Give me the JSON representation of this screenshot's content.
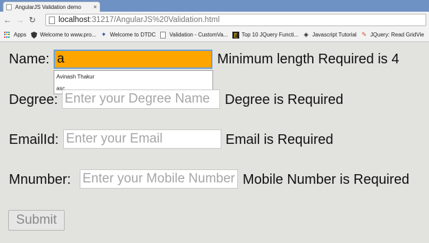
{
  "browser": {
    "tab_title": "AngularJS Validation demo",
    "tab_close": "×",
    "url_host": "localhost",
    "url_path": ":31217/AngularJS%20Validation.html",
    "bookmarks": [
      {
        "label": "Apps",
        "icon": "apps-icon"
      },
      {
        "label": "Welcome to www.pro...",
        "icon": "shield-icon"
      },
      {
        "label": "Welcome to DTDC",
        "icon": "runner-icon"
      },
      {
        "label": "Validation - CustomVa...",
        "icon": "page-icon"
      },
      {
        "label": "Top 10 JQuery Functi...",
        "icon": "e-icon"
      },
      {
        "label": "Javascript Tutorial",
        "icon": "diamond-icon"
      },
      {
        "label": "JQuery: Read GridVie",
        "icon": "blog-icon"
      }
    ]
  },
  "form": {
    "name": {
      "label": "Name:",
      "value": "a",
      "message": "Minimum length Required is 4",
      "autocomplete": [
        "Avinash Thakur",
        "asc"
      ]
    },
    "degree": {
      "label": "Degree:",
      "placeholder": "Enter your Degree Name",
      "message": "Degree is Required"
    },
    "email": {
      "label": "EmailId:",
      "placeholder": "Enter your Email",
      "message": "Email is Required"
    },
    "mobile": {
      "label": "Mnumber:",
      "placeholder": "Enter your Mobile Number",
      "message": "Mobile Number is Required"
    },
    "submit_label": "Submit"
  },
  "colors": {
    "focused_field_bg": "#ffa500",
    "tabstrip_bg": "#6f92c4",
    "page_bg": "#e2e3df"
  }
}
